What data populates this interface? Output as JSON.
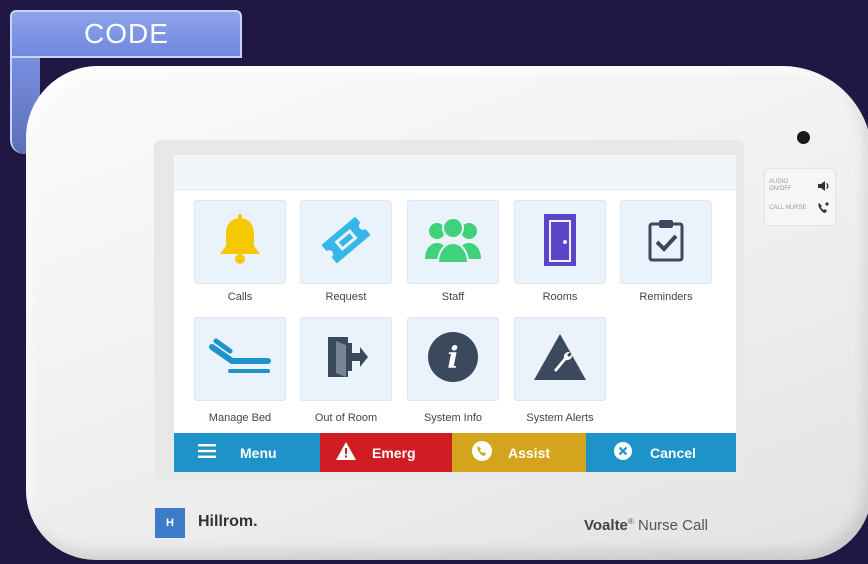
{
  "code_tab": {
    "label": "CODE"
  },
  "side_panel": {
    "row1": "AUDIO ON/OFF",
    "row2": "CALL NURSE"
  },
  "tiles": [
    {
      "label": "Calls",
      "icon": "bell-icon",
      "color": "#f5c800"
    },
    {
      "label": "Request",
      "icon": "ticket-icon",
      "color": "#36b7e8"
    },
    {
      "label": "Staff",
      "icon": "staff-group-icon",
      "color": "#3fd27a"
    },
    {
      "label": "Rooms",
      "icon": "door-icon",
      "color": "#5a45c9"
    },
    {
      "label": "Reminders",
      "icon": "clipboard-check-icon",
      "color": "#3a4a5c"
    },
    {
      "label": "Manage Bed",
      "icon": "bed-icon",
      "color": "#1e93c9"
    },
    {
      "label": "Out of Room",
      "icon": "exit-door-icon",
      "color": "#3a4a5c"
    },
    {
      "label": "System Info",
      "icon": "info-icon",
      "color": "#3a4a5c"
    },
    {
      "label": "System Alerts",
      "icon": "alert-wrench-icon",
      "color": "#3a4a5c"
    }
  ],
  "bottom_bar": {
    "menu": "Menu",
    "emerg": "Emerg",
    "assist": "Assist",
    "cancel": "Cancel"
  },
  "brand": {
    "logo_text": "H",
    "name": "Hillrom."
  },
  "product": {
    "name_bold": "Voalte",
    "mark": "®",
    "name_rest": " Nurse Call"
  }
}
